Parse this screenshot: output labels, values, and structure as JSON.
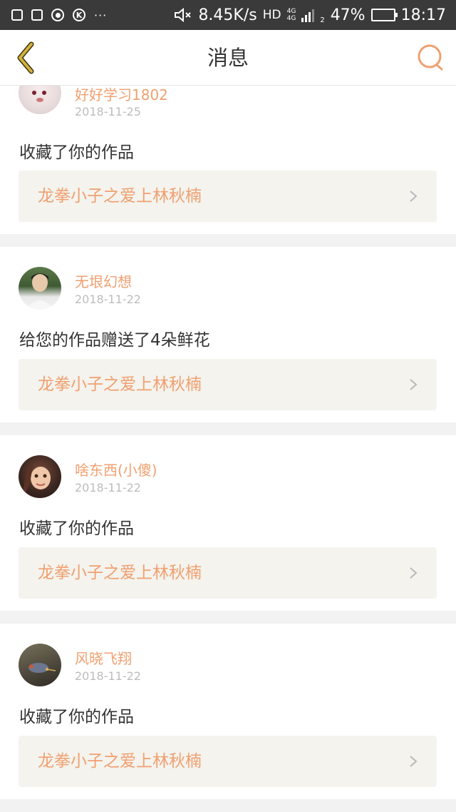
{
  "status_bar": {
    "left_icons": [
      "image-icon",
      "image-edit-icon",
      "record-icon",
      "k-icon"
    ],
    "more": "···",
    "speed": "8.45K/s",
    "hd": "HD",
    "net_a": "4G",
    "net_b": "4G",
    "sim": "2",
    "battery": "47%",
    "battery_level": 0.47,
    "time": "18:17"
  },
  "nav": {
    "title": "消息",
    "back_icon": "chevron-left-icon",
    "search_icon": "search-icon"
  },
  "colors": {
    "accent": "#f0a070",
    "back": "#d4b23a",
    "card_bg": "#ffffff",
    "work_bg": "#f4f3ee",
    "page_bg": "#f2f2f2"
  },
  "messages": [
    {
      "user": "好好学习1802",
      "date": "2018-11-25",
      "action": "收藏了你的作品",
      "work": "龙拳小子之爱上林秋楠",
      "avatar": "avatar-dog"
    },
    {
      "user": "无垠幻想",
      "date": "2018-11-22",
      "action": "给您的作品赠送了4朵鲜花",
      "work": "龙拳小子之爱上林秋楠",
      "avatar": "avatar-boy"
    },
    {
      "user": "啥东西(小傻)",
      "date": "2018-11-22",
      "action": "收藏了你的作品",
      "work": "龙拳小子之爱上林秋楠",
      "avatar": "avatar-girl"
    },
    {
      "user": "风晓飞翔",
      "date": "2018-11-22",
      "action": "收藏了你的作品",
      "work": "龙拳小子之爱上林秋楠",
      "avatar": "avatar-toy"
    }
  ]
}
